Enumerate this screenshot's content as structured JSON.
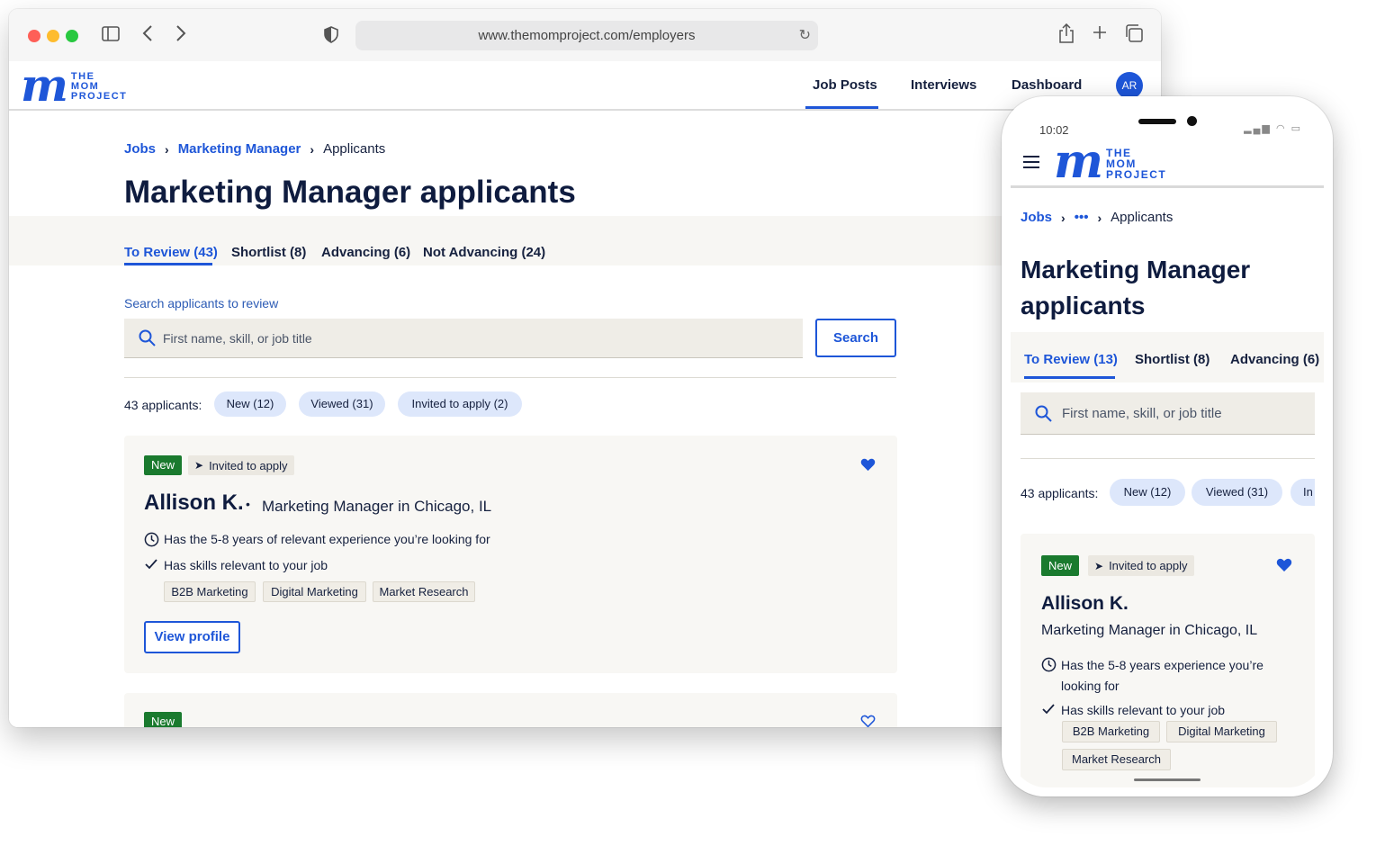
{
  "browser": {
    "url": "www.themomproject.com/employers"
  },
  "brand": {
    "mark": "m",
    "line1": "THE",
    "line2": "MOM",
    "line3": "PROJECT",
    "color": "#1e56d8"
  },
  "nav": {
    "items": [
      "Job Posts",
      "Interviews",
      "Dashboard"
    ],
    "active": "Job Posts",
    "avatar_initials": "AR"
  },
  "breadcrumb": {
    "jobs": "Jobs",
    "job": "Marketing Manager",
    "current": "Applicants",
    "collapsed": "•••"
  },
  "page": {
    "title": "Marketing Manager applicants"
  },
  "tabs": [
    {
      "label": "To Review (43)",
      "active": true
    },
    {
      "label": "Shortlist (8)"
    },
    {
      "label": "Advancing (6)"
    },
    {
      "label": "Not Advancing (24)"
    }
  ],
  "mobile_tabs": [
    {
      "label": "To Review (13)",
      "active": true
    },
    {
      "label": "Shortlist (8)"
    },
    {
      "label": "Advancing (6)"
    }
  ],
  "search": {
    "label": "Search applicants to review",
    "placeholder": "First name, skill, or job title",
    "button": "Search"
  },
  "filters": {
    "count_label": "43 applicants:",
    "chips": [
      "New (12)",
      "Viewed (31)",
      "Invited to apply (2)"
    ],
    "mobile_chip_partial": "In"
  },
  "candidate": {
    "badge_new": "New",
    "badge_invited": "Invited to apply",
    "name": "Allison K.",
    "separator": "•",
    "role": "Marketing Manager in Chicago, IL",
    "experience": "Has the 5-8 years of relevant experience you’re looking for",
    "experience_mobile_1": "Has the 5-8 years experience you’re",
    "experience_mobile_2": "looking for",
    "skills_line": "Has skills relevant to your job",
    "skills": [
      "B2B Marketing",
      "Digital Marketing",
      "Market Research"
    ],
    "view_button": "View profile",
    "favorited": true
  },
  "next_candidate": {
    "badge_new": "New",
    "favorited": false
  },
  "phone": {
    "time": "10:02",
    "status_icons": "▂▄▆ ◠ ▭"
  }
}
